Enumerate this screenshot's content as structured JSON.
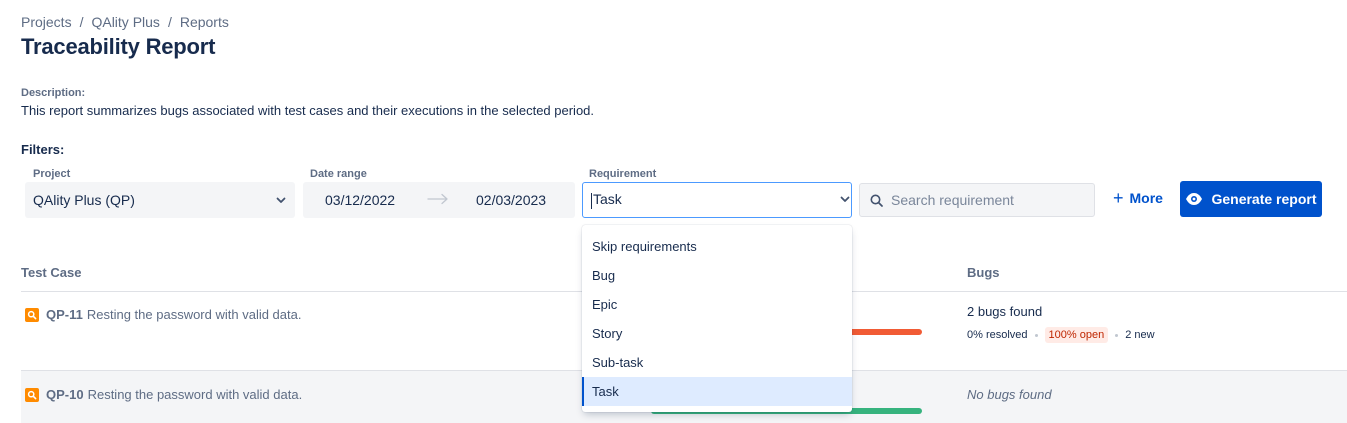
{
  "breadcrumb": [
    "Projects",
    "QAlity Plus",
    "Reports"
  ],
  "page_title": "Traceability Report",
  "description": {
    "label": "Description:",
    "text": "This report summarizes bugs associated with test cases and their executions in the selected period."
  },
  "filters": {
    "label": "Filters:",
    "project": {
      "label": "Project",
      "value": "QAlity Plus (QP)"
    },
    "date_range": {
      "label": "Date range",
      "from": "03/12/2022",
      "to": "02/03/2023"
    },
    "requirement": {
      "label": "Requirement",
      "value": "Task",
      "options": [
        "Skip requirements",
        "Bug",
        "Epic",
        "Story",
        "Sub-task",
        "Task"
      ],
      "selected_index": 5
    },
    "search_placeholder": "Search requirement",
    "more_label": "More",
    "generate_label": "Generate report"
  },
  "table": {
    "columns": {
      "test_case": "Test Case",
      "bugs": "Bugs"
    },
    "rows": [
      {
        "key": "QP-11",
        "summary": "Resting the password with valid data.",
        "bar_color": "#F15B35",
        "bugs_text": "2 bugs found",
        "resolved": "0% resolved",
        "open": "100% open",
        "new": "2 new"
      },
      {
        "key": "QP-10",
        "summary": "Resting the password with valid data.",
        "bar_color": "#36B37E",
        "bugs_text": "No bugs found"
      }
    ]
  },
  "colors": {
    "primary": "#0052CC",
    "focus_border": "#4C9AFF",
    "test_case_icon": "#FF8B00"
  },
  "icons": {
    "chevron": "chevron-down-icon",
    "search": "search-icon",
    "eye": "eye-icon",
    "plus": "plus-icon",
    "arrow": "arrow-right-icon",
    "test_case": "test-case-icon"
  }
}
